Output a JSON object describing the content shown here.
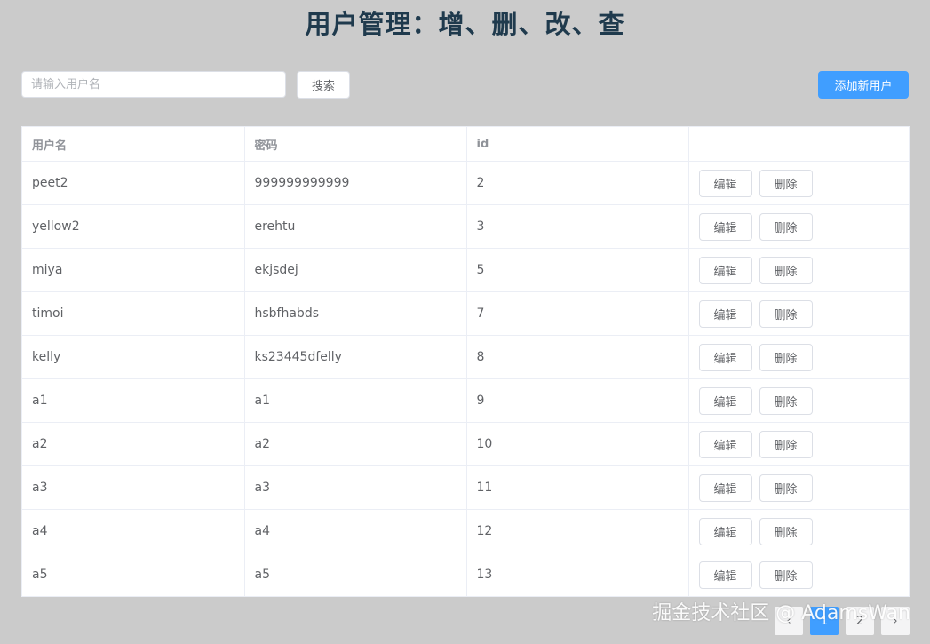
{
  "header": {
    "title": "用户管理：增、删、改、查"
  },
  "toolbar": {
    "search_placeholder": "请输入用户名",
    "search_value": "",
    "search_label": "搜索",
    "add_label": "添加新用户"
  },
  "colors": {
    "background": "#cbcbcb",
    "primary": "#409eff",
    "title": "#1f3a4d"
  },
  "table": {
    "columns": [
      "用户名",
      "密码",
      "id",
      ""
    ],
    "edit_label": "编辑",
    "delete_label": "删除",
    "rows": [
      {
        "username": "peet2",
        "password": "999999999999",
        "id": "2"
      },
      {
        "username": "yellow2",
        "password": "erehtu",
        "id": "3"
      },
      {
        "username": "miya",
        "password": "ekjsdej",
        "id": "5"
      },
      {
        "username": "timoi",
        "password": "hsbfhabds",
        "id": "7"
      },
      {
        "username": "kelly",
        "password": "ks23445dfelly",
        "id": "8"
      },
      {
        "username": "a1",
        "password": "a1",
        "id": "9"
      },
      {
        "username": "a2",
        "password": "a2",
        "id": "10"
      },
      {
        "username": "a3",
        "password": "a3",
        "id": "11"
      },
      {
        "username": "a4",
        "password": "a4",
        "id": "12"
      },
      {
        "username": "a5",
        "password": "a5",
        "id": "13"
      }
    ]
  },
  "pagination": {
    "prev_icon": "chevron-left-icon",
    "prev_symbol": "‹",
    "pages": [
      "1",
      "2"
    ],
    "current_page": "1",
    "next_icon": "chevron-right-icon",
    "next_symbol": "›"
  },
  "watermark": "掘金技术社区 @ AdamsWan"
}
